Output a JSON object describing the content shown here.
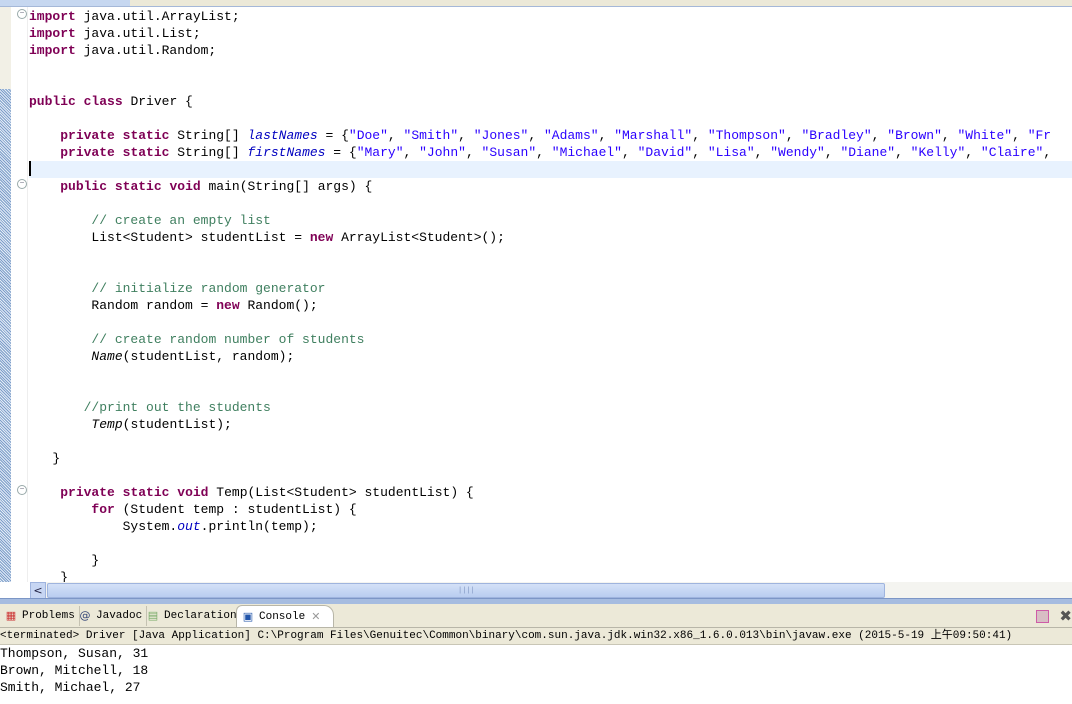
{
  "editor": {
    "lines": [
      [
        [
          "kw",
          "import"
        ],
        [
          "t",
          " java.util.ArrayList;"
        ]
      ],
      [
        [
          "kw",
          "import"
        ],
        [
          "t",
          " java.util.List;"
        ]
      ],
      [
        [
          "kw",
          "import"
        ],
        [
          "t",
          " java.util.Random;"
        ]
      ],
      [],
      [],
      [
        [
          "kw",
          "public"
        ],
        [
          "t",
          " "
        ],
        [
          "kw",
          "class"
        ],
        [
          "t",
          " Driver {"
        ]
      ],
      [],
      [
        [
          "t",
          "    "
        ],
        [
          "kw",
          "private"
        ],
        [
          "t",
          " "
        ],
        [
          "kw",
          "static"
        ],
        [
          "t",
          " String[] "
        ],
        [
          "fld",
          "lastNames"
        ],
        [
          "t",
          " = {"
        ],
        [
          "str",
          "\"Doe\""
        ],
        [
          "t",
          ", "
        ],
        [
          "str",
          "\"Smith\""
        ],
        [
          "t",
          ", "
        ],
        [
          "str",
          "\"Jones\""
        ],
        [
          "t",
          ", "
        ],
        [
          "str",
          "\"Adams\""
        ],
        [
          "t",
          ", "
        ],
        [
          "str",
          "\"Marshall\""
        ],
        [
          "t",
          ", "
        ],
        [
          "str",
          "\"Thompson\""
        ],
        [
          "t",
          ", "
        ],
        [
          "str",
          "\"Bradley\""
        ],
        [
          "t",
          ", "
        ],
        [
          "str",
          "\"Brown\""
        ],
        [
          "t",
          ", "
        ],
        [
          "str",
          "\"White\""
        ],
        [
          "t",
          ", "
        ],
        [
          "str",
          "\"Fr"
        ]
      ],
      [
        [
          "t",
          "    "
        ],
        [
          "kw",
          "private"
        ],
        [
          "t",
          " "
        ],
        [
          "kw",
          "static"
        ],
        [
          "t",
          " String[] "
        ],
        [
          "fld",
          "firstNames"
        ],
        [
          "t",
          " = {"
        ],
        [
          "str",
          "\"Mary\""
        ],
        [
          "t",
          ", "
        ],
        [
          "str",
          "\"John\""
        ],
        [
          "t",
          ", "
        ],
        [
          "str",
          "\"Susan\""
        ],
        [
          "t",
          ", "
        ],
        [
          "str",
          "\"Michael\""
        ],
        [
          "t",
          ", "
        ],
        [
          "str",
          "\"David\""
        ],
        [
          "t",
          ", "
        ],
        [
          "str",
          "\"Lisa\""
        ],
        [
          "t",
          ", "
        ],
        [
          "str",
          "\"Wendy\""
        ],
        [
          "t",
          ", "
        ],
        [
          "str",
          "\"Diane\""
        ],
        [
          "t",
          ", "
        ],
        [
          "str",
          "\"Kelly\""
        ],
        [
          "t",
          ", "
        ],
        [
          "str",
          "\"Claire\""
        ],
        [
          "t",
          ","
        ]
      ],
      [],
      [
        [
          "t",
          "    "
        ],
        [
          "kw",
          "public"
        ],
        [
          "t",
          " "
        ],
        [
          "kw",
          "static"
        ],
        [
          "t",
          " "
        ],
        [
          "kw",
          "void"
        ],
        [
          "t",
          " main(String[] args) {"
        ]
      ],
      [],
      [
        [
          "t",
          "        "
        ],
        [
          "cm",
          "// create an empty list"
        ]
      ],
      [
        [
          "t",
          "        List<Student> studentList = "
        ],
        [
          "kw",
          "new"
        ],
        [
          "t",
          " ArrayList<Student>();"
        ]
      ],
      [],
      [],
      [
        [
          "t",
          "        "
        ],
        [
          "cm",
          "// initialize random generator"
        ]
      ],
      [
        [
          "t",
          "        Random random = "
        ],
        [
          "kw",
          "new"
        ],
        [
          "t",
          " Random();"
        ]
      ],
      [],
      [
        [
          "t",
          "        "
        ],
        [
          "cm",
          "// create random number of students"
        ]
      ],
      [
        [
          "t",
          "        "
        ],
        [
          "it",
          "Name"
        ],
        [
          "t",
          "(studentList, random);"
        ]
      ],
      [],
      [],
      [
        [
          "t",
          "       "
        ],
        [
          "cm",
          "//print out the students"
        ]
      ],
      [
        [
          "t",
          "        "
        ],
        [
          "it",
          "Temp"
        ],
        [
          "t",
          "(studentList);"
        ]
      ],
      [],
      [
        [
          "t",
          "   }"
        ]
      ],
      [],
      [
        [
          "t",
          "    "
        ],
        [
          "kw",
          "private"
        ],
        [
          "t",
          " "
        ],
        [
          "kw",
          "static"
        ],
        [
          "t",
          " "
        ],
        [
          "kw",
          "void"
        ],
        [
          "t",
          " Temp(List<Student> studentList) {"
        ]
      ],
      [
        [
          "t",
          "        "
        ],
        [
          "kw",
          "for"
        ],
        [
          "t",
          " (Student temp : studentList) {"
        ]
      ],
      [
        [
          "t",
          "            System."
        ],
        [
          "fld",
          "out"
        ],
        [
          "t",
          ".println(temp);"
        ]
      ],
      [],
      [
        [
          "t",
          "        }"
        ]
      ],
      [
        [
          "t",
          "    }"
        ]
      ]
    ],
    "current_line": 9
  },
  "panel": {
    "tabs": [
      {
        "label": "Problems",
        "icon": "problems-icon"
      },
      {
        "label": "Javadoc",
        "icon": "javadoc-icon"
      },
      {
        "label": "Declaration",
        "icon": "declaration-icon"
      },
      {
        "label": "Console",
        "icon": "console-icon",
        "active": true
      }
    ],
    "console_header": "<terminated> Driver [Java Application] C:\\Program Files\\Genuitec\\Common\\binary\\com.sun.java.jdk.win32.x86_1.6.0.013\\bin\\javaw.exe (2015-5-19 上午09:50:41)",
    "output": [
      "Thompson, Susan, 31",
      "Brown, Mitchell, 18",
      "Smith, Michael, 27"
    ]
  }
}
